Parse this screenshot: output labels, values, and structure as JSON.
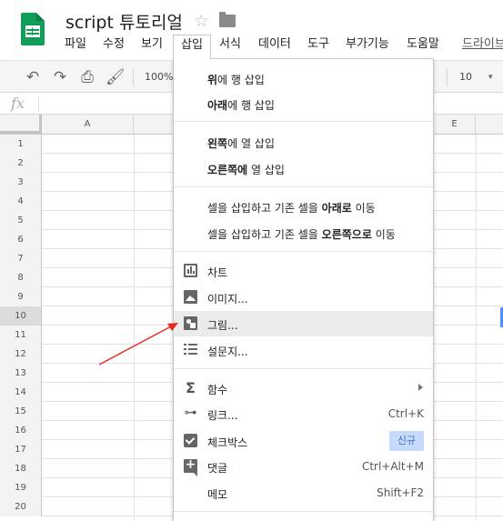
{
  "doc": {
    "title": "script 튜토리얼"
  },
  "menu": {
    "items": [
      {
        "label": "파일"
      },
      {
        "label": "수정"
      },
      {
        "label": "보기"
      },
      {
        "label": "삽입"
      },
      {
        "label": "서식"
      },
      {
        "label": "데이터"
      },
      {
        "label": "도구"
      },
      {
        "label": "부가기능"
      },
      {
        "label": "도움말"
      },
      {
        "label": "드라이브"
      }
    ]
  },
  "toolbar": {
    "zoom": "100%",
    "font_size": "10"
  },
  "grid": {
    "columns": [
      "A",
      "E"
    ],
    "rows": [
      "1",
      "2",
      "3",
      "4",
      "5",
      "6",
      "7",
      "8",
      "9",
      "10",
      "11",
      "12",
      "13",
      "14",
      "15",
      "16",
      "17",
      "18",
      "19",
      "20"
    ],
    "selected_row": "10"
  },
  "insert_menu": {
    "row_above": {
      "bold": "위",
      "rest": "에 행 삽입"
    },
    "row_below": {
      "bold": "아래",
      "rest": "에 행 삽입"
    },
    "col_left": {
      "bold": "왼쪽",
      "rest": "에 열 삽입"
    },
    "col_right": {
      "bold": "오른쪽에",
      "rest": " 열 삽입"
    },
    "shift_down": {
      "pre": "셀을 삽입하고 기존 셀을 ",
      "bold": "아래로",
      "post": " 이동"
    },
    "shift_right": {
      "pre": "셀을 삽입하고 기존 셀을 ",
      "bold": "오른쪽으로",
      "post": " 이동"
    },
    "chart": "차트",
    "image": "이미지...",
    "drawing": "그림...",
    "form": "설문지...",
    "function": "함수",
    "link": {
      "label": "링크...",
      "shortcut": "Ctrl+K"
    },
    "checkbox": {
      "label": "체크박스",
      "badge": "신규"
    },
    "comment": {
      "label": "댓글",
      "shortcut": "Ctrl+Alt+M"
    },
    "note": {
      "label": "메모",
      "shortcut": "Shift+F2"
    }
  },
  "colors": {
    "accent": "#0f9d58",
    "hover": "#ebebeb",
    "annotation": "#e8281f",
    "badge": "#c6dafc"
  }
}
